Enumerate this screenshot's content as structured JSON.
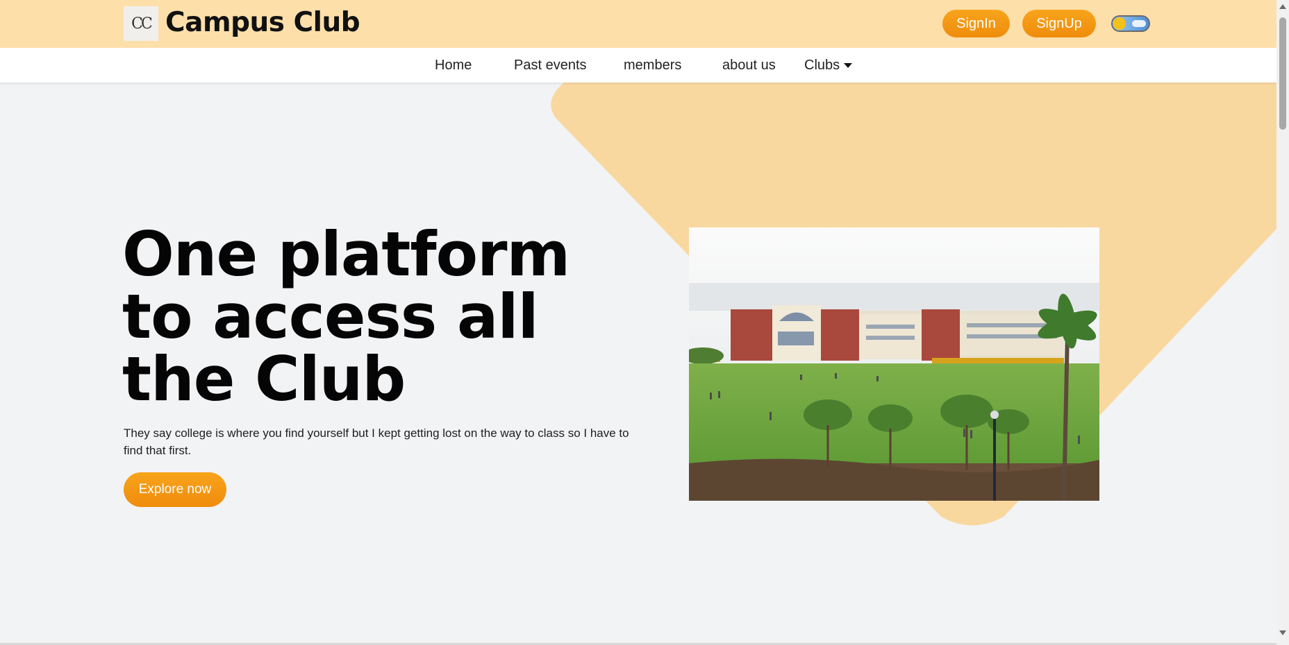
{
  "header": {
    "logo_text": "CC",
    "brand": "Campus Club",
    "signin_label": "SignIn",
    "signup_label": "SignUp",
    "theme_toggle": "day-night-toggle-icon"
  },
  "nav": {
    "items": [
      {
        "label": "Home"
      },
      {
        "label": "Past events"
      },
      {
        "label": "members"
      },
      {
        "label": "about us"
      },
      {
        "label": "Clubs"
      }
    ]
  },
  "hero": {
    "title": "One platform to access all the Club",
    "subtitle": "They say college is where you find yourself but I kept getting lost on the way to class so I have to find that first.",
    "cta_label": "Explore now",
    "image": "campus-building-photo"
  },
  "colors": {
    "header_bg": "#fddfaa",
    "accent": "#f39a14",
    "deco_shape": "#f9d8a0",
    "page_bg": "#f2f3f5"
  }
}
